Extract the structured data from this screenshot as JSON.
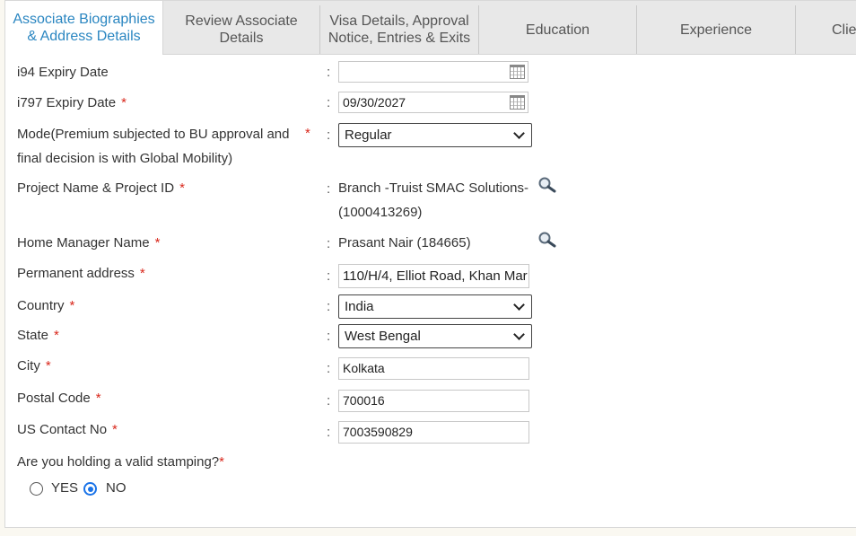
{
  "tabs": [
    {
      "label_line1": "Associate Biographies",
      "label_line2": "& Address Details"
    },
    {
      "label_line1": "Review Associate",
      "label_line2": "Details"
    },
    {
      "label_line1": "Visa Details, Approval",
      "label_line2": "Notice, Entries & Exits"
    },
    {
      "label": "Education"
    },
    {
      "label": "Experience"
    },
    {
      "label": "Clie"
    }
  ],
  "form": {
    "colon": ":",
    "required_mark": "*",
    "i94": {
      "label": "i94 Expiry Date",
      "value": ""
    },
    "i797": {
      "label": "i797 Expiry Date",
      "value": "09/30/2027"
    },
    "mode": {
      "label_line1": "Mode(Premium subjected to BU approval and",
      "label_line2": "final decision is with Global Mobility)",
      "value": "Regular"
    },
    "project": {
      "label": "Project Name & Project ID",
      "value_line1": "Branch -Truist SMAC Solutions-",
      "value_line2": "(1000413269)"
    },
    "manager": {
      "label": "Home Manager Name",
      "value": "Prasant Nair (184665)"
    },
    "address": {
      "label": "Permanent address",
      "value": "110/H/4, Elliot Road, Khan Mar"
    },
    "country": {
      "label": "Country",
      "value": "India"
    },
    "state": {
      "label": "State",
      "value": "West Bengal"
    },
    "city": {
      "label": "City",
      "value": "Kolkata"
    },
    "postal": {
      "label": "Postal Code",
      "value": "700016"
    },
    "contact": {
      "label": "US Contact No",
      "value": "7003590829"
    },
    "stamping": {
      "label": "Are you holding a valid stamping?",
      "yes": "YES",
      "no": "NO",
      "selected": "NO"
    }
  },
  "colors": {
    "accent": "#2a86c1",
    "required": "#d9281c",
    "radio": "#1a73e8"
  }
}
